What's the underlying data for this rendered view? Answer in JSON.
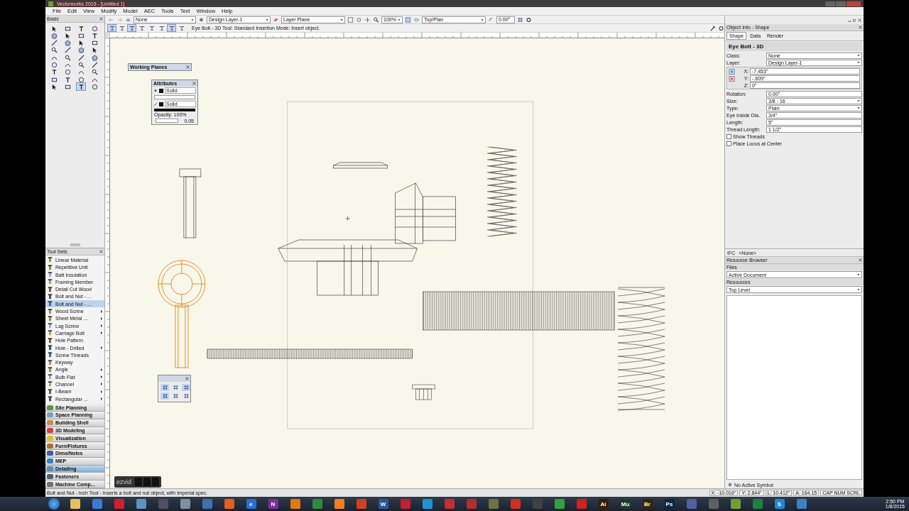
{
  "window": {
    "title": "Vectorworks 2015 - [Untitled 1]"
  },
  "menu": [
    "File",
    "Edit",
    "View",
    "Modify",
    "Model",
    "AEC",
    "Tools",
    "Text",
    "Window",
    "Help"
  ],
  "view_bar": {
    "class": "None",
    "layer": "Design Layer-1",
    "plane": "Layer Plane",
    "zoom": "100%",
    "view": "Top/Plan",
    "rotation": "0.00°"
  },
  "mode_bar": {
    "modes": [
      {
        "selected": true
      },
      {
        "selected": false
      },
      {
        "selected": true
      },
      {
        "selected": false
      },
      {
        "selected": false
      },
      {
        "selected": false
      },
      {
        "selected": true
      },
      {
        "selected": false
      }
    ],
    "help": "Eye Bolt - 3D Tool: Standard Insertion Mode: Insert object."
  },
  "basic_palette": {
    "title": "Basic",
    "tools": [
      {
        "selected": false
      },
      {
        "selected": false
      },
      {
        "selected": false
      },
      {
        "selected": false
      },
      {
        "selected": false
      },
      {
        "selected": false
      },
      {
        "selected": false
      },
      {
        "selected": false
      },
      {
        "selected": false
      },
      {
        "selected": false
      },
      {
        "selected": false
      },
      {
        "selected": false
      },
      {
        "selected": false
      },
      {
        "selected": false
      },
      {
        "selected": false
      },
      {
        "selected": false
      },
      {
        "selected": false
      },
      {
        "selected": false
      },
      {
        "selected": false
      },
      {
        "selected": false
      },
      {
        "selected": false
      },
      {
        "selected": false
      },
      {
        "selected": false
      },
      {
        "selected": false
      },
      {
        "selected": false
      },
      {
        "selected": false
      },
      {
        "selected": false
      },
      {
        "selected": false
      },
      {
        "selected": false
      },
      {
        "selected": false
      },
      {
        "selected": false
      },
      {
        "selected": false
      },
      {
        "selected": false
      },
      {
        "selected": false
      },
      {
        "selected": true
      },
      {
        "selected": false
      }
    ]
  },
  "tool_sets": {
    "title": "Tool Sets",
    "tools": [
      {
        "label": "Linear Material",
        "flyout": false,
        "selected": false
      },
      {
        "label": "Repetitive Unit",
        "flyout": false,
        "selected": false
      },
      {
        "label": "Batt Insulation",
        "flyout": false,
        "selected": false
      },
      {
        "label": "Framing Member",
        "flyout": false,
        "selected": false
      },
      {
        "label": "Detail Cut Wood",
        "flyout": false,
        "selected": false
      },
      {
        "label": "Bolt and Nut - ...",
        "flyout": false,
        "selected": false
      },
      {
        "label": "Bolt and Nut - ...",
        "flyout": false,
        "selected": true
      },
      {
        "label": "Wood Screw",
        "flyout": true,
        "selected": false
      },
      {
        "label": "Sheet Metal ...",
        "flyout": true,
        "selected": false
      },
      {
        "label": "Lag Screw",
        "flyout": true,
        "selected": false
      },
      {
        "label": "Carriage Bolt",
        "flyout": true,
        "selected": false
      },
      {
        "label": "Hole Pattern",
        "flyout": false,
        "selected": false
      },
      {
        "label": "Hole - Drilled",
        "flyout": true,
        "selected": false
      },
      {
        "label": "Screw Threads",
        "flyout": false,
        "selected": false
      },
      {
        "label": "Keyway",
        "flyout": false,
        "selected": false
      },
      {
        "label": "Angle",
        "flyout": true,
        "selected": false
      },
      {
        "label": "Bulb Flat",
        "flyout": true,
        "selected": false
      },
      {
        "label": "Channel",
        "flyout": true,
        "selected": false
      },
      {
        "label": "I-Beam",
        "flyout": true,
        "selected": false
      },
      {
        "label": "Rectangular ...",
        "flyout": true,
        "selected": false
      }
    ],
    "categories": [
      {
        "label": "Site Planning",
        "selected": false
      },
      {
        "label": "Space Planning",
        "selected": false
      },
      {
        "label": "Building Shell",
        "selected": false
      },
      {
        "label": "3D Modeling",
        "selected": false
      },
      {
        "label": "Visualization",
        "selected": false
      },
      {
        "label": "Furn/Fixtures",
        "selected": false
      },
      {
        "label": "Dims/Notes",
        "selected": false
      },
      {
        "label": "MEP",
        "selected": false
      },
      {
        "label": "Detailing",
        "selected": true
      },
      {
        "label": "Fasteners",
        "selected": false
      },
      {
        "label": "Machine Comp...",
        "selected": false
      }
    ]
  },
  "floating_palettes": {
    "working_planes": {
      "title": "Working Planes"
    },
    "attributes": {
      "title": "Attributes",
      "fill": "Solid",
      "pen": "Solid",
      "opacity": "Opacity: 100%",
      "thickness": "0.05"
    }
  },
  "object_info": {
    "title": "Object Info - Shape",
    "tabs": [
      {
        "label": "Shape",
        "selected": true
      },
      {
        "label": "Data",
        "selected": false
      },
      {
        "label": "Render",
        "selected": false
      }
    ],
    "object": "Eye Bolt - 3D",
    "fields": [
      {
        "kind": "select",
        "label": "Class:",
        "value": "None"
      },
      {
        "kind": "select",
        "label": "Layer:",
        "value": "Design Layer-1"
      },
      {
        "kind": "coord",
        "label": "X:",
        "value": "-7.453\""
      },
      {
        "kind": "coord",
        "label": "Y:",
        "value": "-.609\""
      },
      {
        "kind": "coord",
        "label": "Z:",
        "value": "0\""
      },
      {
        "kind": "text",
        "label": "Rotation:",
        "value": "0.00°"
      },
      {
        "kind": "select",
        "label": "Size:",
        "value": "3/8 - 16"
      },
      {
        "kind": "select",
        "label": "Type:",
        "value": "Plain"
      },
      {
        "kind": "text",
        "label": "Eye Inside Dia.",
        "value": "3/4\""
      },
      {
        "kind": "text",
        "label": "Length:",
        "value": "5\""
      },
      {
        "kind": "text",
        "label": "Thread Length:",
        "value": "1 1/2\""
      },
      {
        "kind": "check",
        "label": "Show Threads",
        "checked": false
      },
      {
        "kind": "check",
        "label": "Place Locus at Center",
        "checked": false
      }
    ]
  },
  "ifc": {
    "label": "IFC",
    "value": "<None>"
  },
  "resource_browser": {
    "title": "Resource Browser",
    "files_label": "Files",
    "file": "Active Document",
    "resources_label": "Resources",
    "folder": "Top Level"
  },
  "status_bar": {
    "help": "Bolt and Nut - Inch Tool - Inserts a bolt and nut object, with imperial spec.",
    "symbol": "No Active Symbol",
    "readouts": [
      "X: -10.016\"",
      "Y: 2.844\"",
      "L: 10.412\"",
      "A: 164.15",
      "CAP NUM SCRL"
    ]
  },
  "recorder": {
    "logo": "ezvid"
  },
  "taskbar": {
    "apps": [
      {
        "color": "#e8c060"
      },
      {
        "color": "#3a7bd5"
      },
      {
        "color": "#d02030"
      },
      {
        "color": "#6090c0"
      },
      {
        "color": "#505060"
      },
      {
        "color": "#8090a0"
      },
      {
        "color": "#4070b0"
      },
      {
        "color": "#e06020"
      },
      {
        "color": "#2a6ed6",
        "label": "e"
      },
      {
        "color": "#7a2f9a",
        "label": "N"
      },
      {
        "color": "#e07a10"
      },
      {
        "color": "#2e8b3e"
      },
      {
        "color": "#f08020"
      },
      {
        "color": "#d04020"
      },
      {
        "color": "#2b5797",
        "label": "W"
      },
      {
        "color": "#c02030"
      },
      {
        "color": "#2090d0"
      },
      {
        "color": "#c03030"
      },
      {
        "color": "#b03030"
      },
      {
        "color": "#707040"
      },
      {
        "color": "#d03020"
      },
      {
        "color": "#404040"
      },
      {
        "color": "#30a040"
      },
      {
        "color": "#d02020"
      },
      {
        "color": "#3a1d00",
        "label": "Ai"
      },
      {
        "color": "#1e3a2a",
        "label": "Mu"
      },
      {
        "color": "#3a2400",
        "label": "Br"
      },
      {
        "color": "#0a2840",
        "label": "Ps"
      },
      {
        "color": "#5060a0"
      },
      {
        "color": "#606060"
      },
      {
        "color": "#70a030"
      },
      {
        "color": "#208040"
      },
      {
        "color": "#1a8ad4",
        "label": "S"
      },
      {
        "color": "#4080c0"
      }
    ],
    "time": "2:50 PM",
    "date": "1/8/2015"
  }
}
